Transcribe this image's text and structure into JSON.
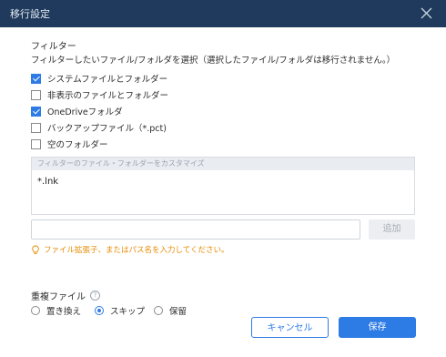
{
  "window": {
    "title": "移行設定"
  },
  "filter": {
    "section_title": "フィルター",
    "description": "フィルターしたいファイル/フォルダを選択（選択したファイル/フォルダは移行されません。）",
    "options": [
      {
        "label": "システムファイルとフォルダー",
        "checked": true
      },
      {
        "label": "非表示のファイルとフォルダー",
        "checked": false
      },
      {
        "label": "OneDriveフォルダ",
        "checked": true
      },
      {
        "label": "バックアップファイル（*.pct)",
        "checked": false
      },
      {
        "label": "空のフォルダー",
        "checked": false
      }
    ],
    "custom_header": "フィルターのファイル・フォルダーをカスタマイズ",
    "custom_entries": [
      "*.lnk"
    ],
    "input_value": "",
    "add_button": "追加",
    "hint": "ファイル拡張子、またはパス名を入力してください。"
  },
  "duplicate": {
    "title": "重複ファイル",
    "help_icon": "?",
    "options": [
      {
        "label": "置き換え",
        "selected": false
      },
      {
        "label": "スキップ",
        "selected": true
      },
      {
        "label": "保留",
        "selected": false
      }
    ]
  },
  "buttons": {
    "cancel": "キャンセル",
    "save": "保存"
  },
  "colors": {
    "title_bar": "#1f3a5c",
    "accent": "#2d7be4",
    "hint": "#e58a00"
  }
}
